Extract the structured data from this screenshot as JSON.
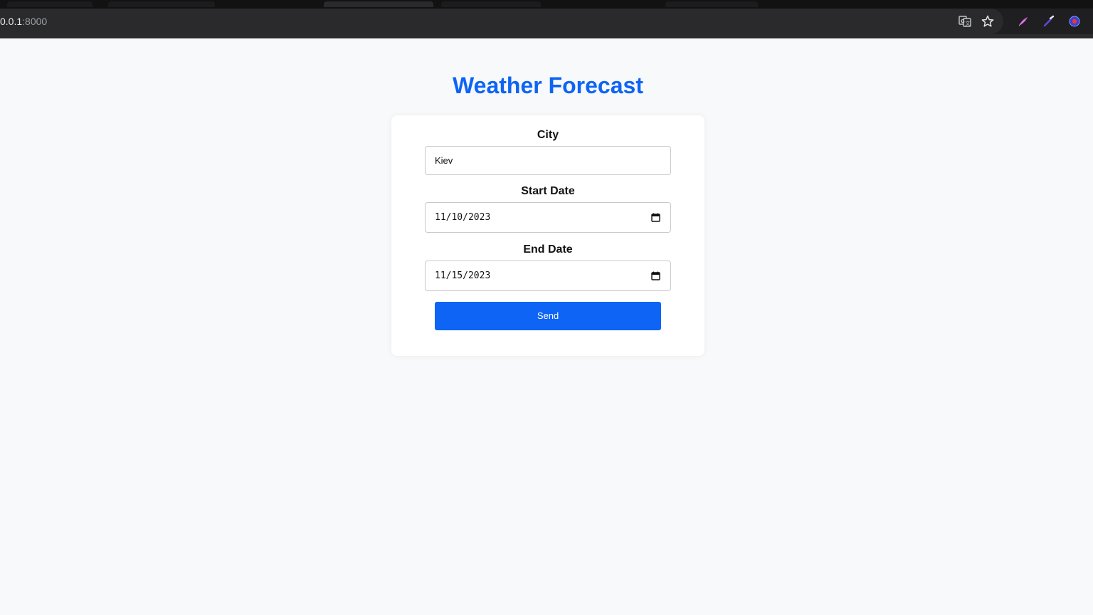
{
  "browser": {
    "url_host": "0.0.1",
    "url_port": ":8000",
    "icons": [
      "translate-icon",
      "star-icon",
      "extension-feather-icon",
      "eyedropper-icon",
      "extension-globe-icon"
    ]
  },
  "page": {
    "title": "Weather Forecast"
  },
  "form": {
    "city": {
      "label": "City",
      "value": "Kiev"
    },
    "start_date": {
      "label": "Start Date",
      "value": "11/10/2023"
    },
    "end_date": {
      "label": "End Date",
      "value": "11/15/2023"
    },
    "submit_label": "Send"
  },
  "colors": {
    "accent": "#0d64f5",
    "page_background": "#f8f9fa",
    "card_background": "#ffffff",
    "browser_chrome": "#202124"
  }
}
